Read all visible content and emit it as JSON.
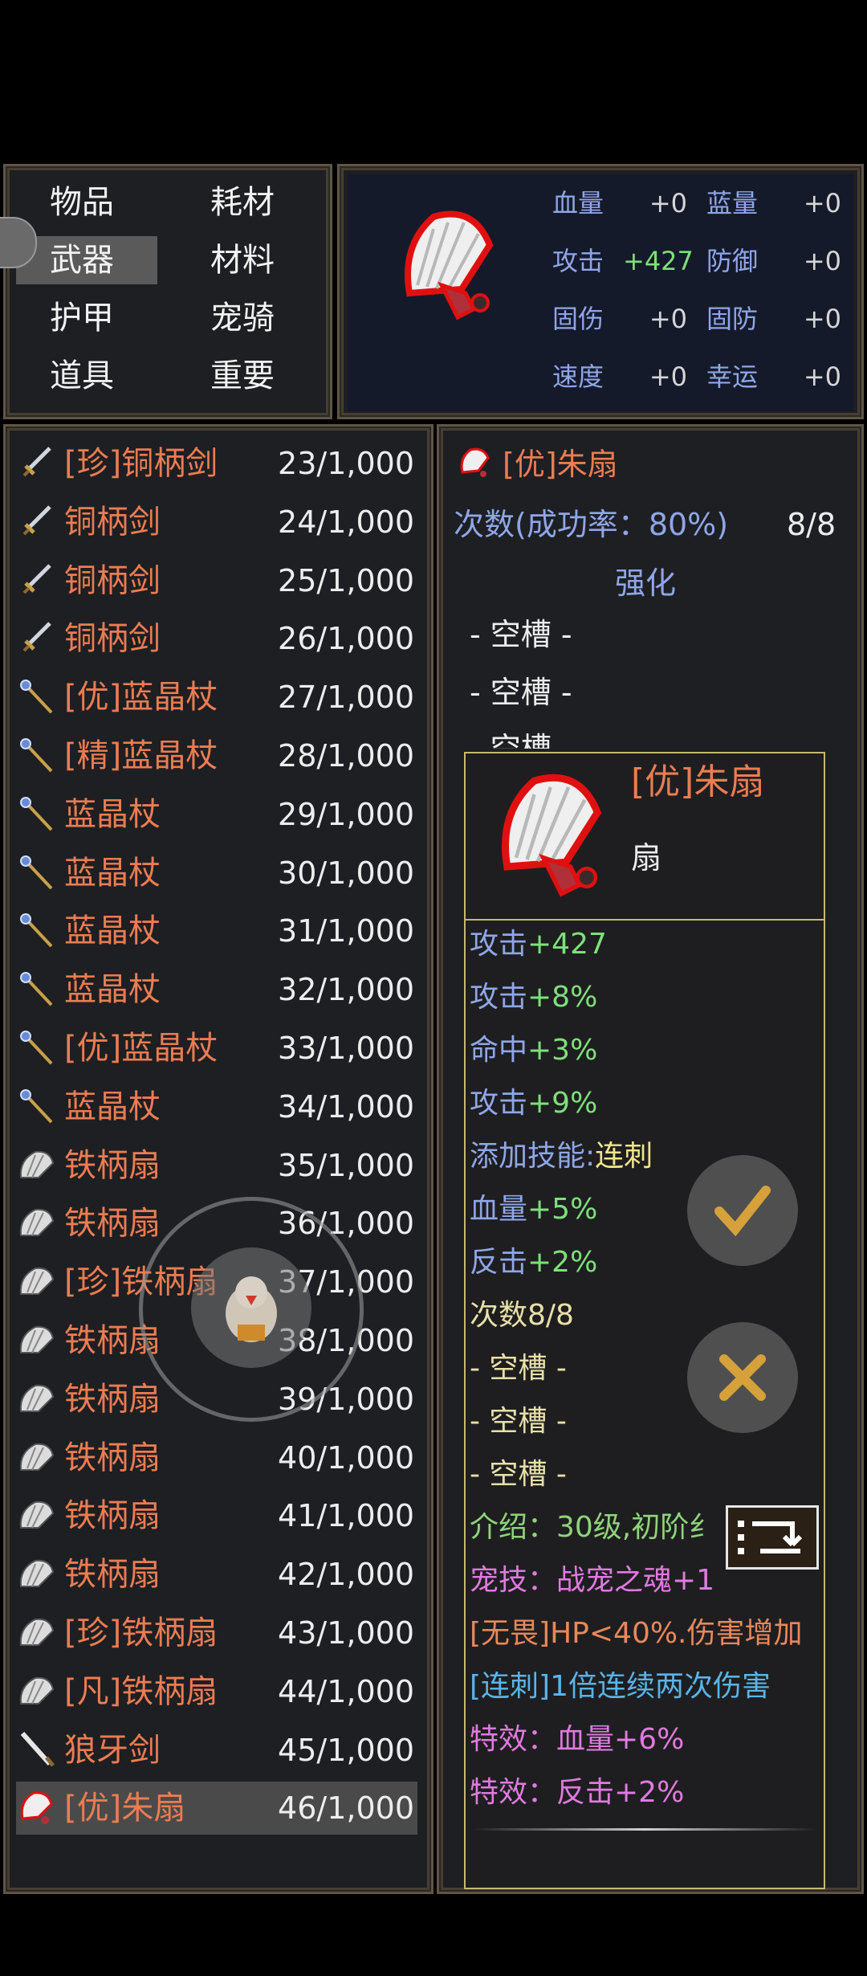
{
  "categories": [
    {
      "label": "物品",
      "active": false
    },
    {
      "label": "耗材",
      "active": false
    },
    {
      "label": "武器",
      "active": true
    },
    {
      "label": "材料",
      "active": false
    },
    {
      "label": "护甲",
      "active": false
    },
    {
      "label": "宠骑",
      "active": false
    },
    {
      "label": "道具",
      "active": false
    },
    {
      "label": "重要",
      "active": false
    }
  ],
  "stats": [
    {
      "name": "血量",
      "value": "+0"
    },
    {
      "name": "蓝量",
      "value": "+0"
    },
    {
      "name": "攻击",
      "value": "+427"
    },
    {
      "name": "防御",
      "value": "+0"
    },
    {
      "name": "固伤",
      "value": "+0"
    },
    {
      "name": "固防",
      "value": "+0"
    },
    {
      "name": "速度",
      "value": "+0"
    },
    {
      "name": "幸运",
      "value": "+0"
    }
  ],
  "items": [
    {
      "icon": "sword-icon",
      "name": "[珍]铜柄剑",
      "qty": "23/1,000"
    },
    {
      "icon": "sword-icon",
      "name": "铜柄剑",
      "qty": "24/1,000"
    },
    {
      "icon": "sword-icon",
      "name": "铜柄剑",
      "qty": "25/1,000"
    },
    {
      "icon": "sword-icon",
      "name": "铜柄剑",
      "qty": "26/1,000"
    },
    {
      "icon": "staff-icon",
      "name": "[优]蓝晶杖",
      "qty": "27/1,000"
    },
    {
      "icon": "staff-icon",
      "name": "[精]蓝晶杖",
      "qty": "28/1,000"
    },
    {
      "icon": "staff-icon",
      "name": "蓝晶杖",
      "qty": "29/1,000"
    },
    {
      "icon": "staff-icon",
      "name": "蓝晶杖",
      "qty": "30/1,000"
    },
    {
      "icon": "staff-icon",
      "name": "蓝晶杖",
      "qty": "31/1,000"
    },
    {
      "icon": "staff-icon",
      "name": "蓝晶杖",
      "qty": "32/1,000"
    },
    {
      "icon": "staff-icon",
      "name": "[优]蓝晶杖",
      "qty": "33/1,000"
    },
    {
      "icon": "staff-icon",
      "name": "蓝晶杖",
      "qty": "34/1,000"
    },
    {
      "icon": "fan-icon",
      "name": "铁柄扇",
      "qty": "35/1,000"
    },
    {
      "icon": "fan-icon",
      "name": "铁柄扇",
      "qty": "36/1,000"
    },
    {
      "icon": "fan-icon",
      "name": "[珍]铁柄扇",
      "qty": "37/1,000"
    },
    {
      "icon": "fan-icon",
      "name": "铁柄扇",
      "qty": "38/1,000"
    },
    {
      "icon": "fan-icon",
      "name": "铁柄扇",
      "qty": "39/1,000"
    },
    {
      "icon": "fan-icon",
      "name": "铁柄扇",
      "qty": "40/1,000"
    },
    {
      "icon": "fan-icon",
      "name": "铁柄扇",
      "qty": "41/1,000"
    },
    {
      "icon": "fan-icon",
      "name": "铁柄扇",
      "qty": "42/1,000"
    },
    {
      "icon": "fan-icon",
      "name": "[珍]铁柄扇",
      "qty": "43/1,000"
    },
    {
      "icon": "fan-icon",
      "name": "[凡]铁柄扇",
      "qty": "44/1,000"
    },
    {
      "icon": "fang-sword-icon",
      "name": "狼牙剑",
      "qty": "45/1,000"
    },
    {
      "icon": "red-fan-icon",
      "name": "[优]朱扇",
      "qty": "46/1,000",
      "selected": true
    }
  ],
  "detail": {
    "title": "[优]朱扇",
    "count_label": "次数(成功率：80%)",
    "count_value": "8/8",
    "enhance_label": "强化",
    "slots": [
      "- 空槽 -",
      "- 空槽 -",
      "- 空槽 -"
    ]
  },
  "tooltip": {
    "title": "[优]朱扇",
    "type": "扇",
    "lines": [
      {
        "text": "攻击+427",
        "color": "#7ee07a",
        "prefix": "攻击",
        "suffix": "+427",
        "prefixColor": "#8fa6e8"
      },
      {
        "text": "攻击+8%",
        "prefix": "攻击",
        "suffix": "+8%",
        "prefixColor": "#8fa6e8",
        "color": "#7ee07a"
      },
      {
        "text": "命中+3%",
        "prefix": "命中",
        "suffix": "+3%",
        "prefixColor": "#8fa6e8",
        "color": "#7ee07a"
      },
      {
        "text": "攻击+9%",
        "prefix": "攻击",
        "suffix": "+9%",
        "prefixColor": "#8fa6e8",
        "color": "#7ee07a"
      },
      {
        "text": "添加技能:连刺",
        "prefix": "添加技能:",
        "suffix": "连刺",
        "prefixColor": "#8fa6e8",
        "color": "#f0e68c"
      },
      {
        "text": "血量+5%",
        "prefix": "血量",
        "suffix": "+5%",
        "prefixColor": "#8fa6e8",
        "color": "#7ee07a"
      },
      {
        "text": "反击+2%",
        "prefix": "反击",
        "suffix": "+2%",
        "prefixColor": "#8fa6e8",
        "color": "#7ee07a"
      },
      {
        "text": "次数8/8",
        "prefix": "次数",
        "suffix": "8/8",
        "prefixColor": "#e8e0a8",
        "color": "#e8e0a8"
      },
      {
        "text": "  - 空槽 -",
        "prefix": "",
        "suffix": "  - 空槽 -",
        "prefixColor": "#e8e0a8",
        "color": "#e8e0a8"
      },
      {
        "text": "  - 空槽 -",
        "prefix": "",
        "suffix": "  - 空槽 -",
        "prefixColor": "#e8e0a8",
        "color": "#e8e0a8"
      },
      {
        "text": "  - 空槽 -",
        "prefix": "",
        "suffix": "  - 空槽 -",
        "prefixColor": "#e8e0a8",
        "color": "#e8e0a8"
      },
      {
        "text": "介绍：30级,初阶纟",
        "prefix": "",
        "suffix": "介绍：30级,初阶纟",
        "prefixColor": "#8fd47a",
        "color": "#8fd47a"
      },
      {
        "text": "宠技：战宠之魂+1",
        "prefix": "",
        "suffix": "宠技：战宠之魂+1",
        "prefixColor": "#d47ad4",
        "color": "#e07ae0"
      },
      {
        "text": "[无畏]HP<40%.伤害增加",
        "prefix": "",
        "suffix": "[无畏]HP<40%.伤害增加",
        "prefixColor": "#e8885a",
        "color": "#e8885a"
      },
      {
        "text": "[连刺]1倍连续两次伤害",
        "prefix": "",
        "suffix": "[连刺]1倍连续两次伤害",
        "prefixColor": "#5ab4e8",
        "color": "#5ab4e8"
      },
      {
        "text": "特效：血量+6%",
        "prefix": "",
        "suffix": "特效：血量+6%",
        "prefixColor": "#e07ae0",
        "color": "#e07ae0"
      },
      {
        "text": "特效：反击+2%",
        "prefix": "",
        "suffix": "特效：反击+2%",
        "prefixColor": "#e07ae0",
        "color": "#e07ae0"
      }
    ]
  },
  "colors": {
    "item_name": "#ec7c52",
    "stat_name": "#8fa6e8",
    "stat_green": "#7ee07a",
    "panel_border": "#5f5547"
  }
}
